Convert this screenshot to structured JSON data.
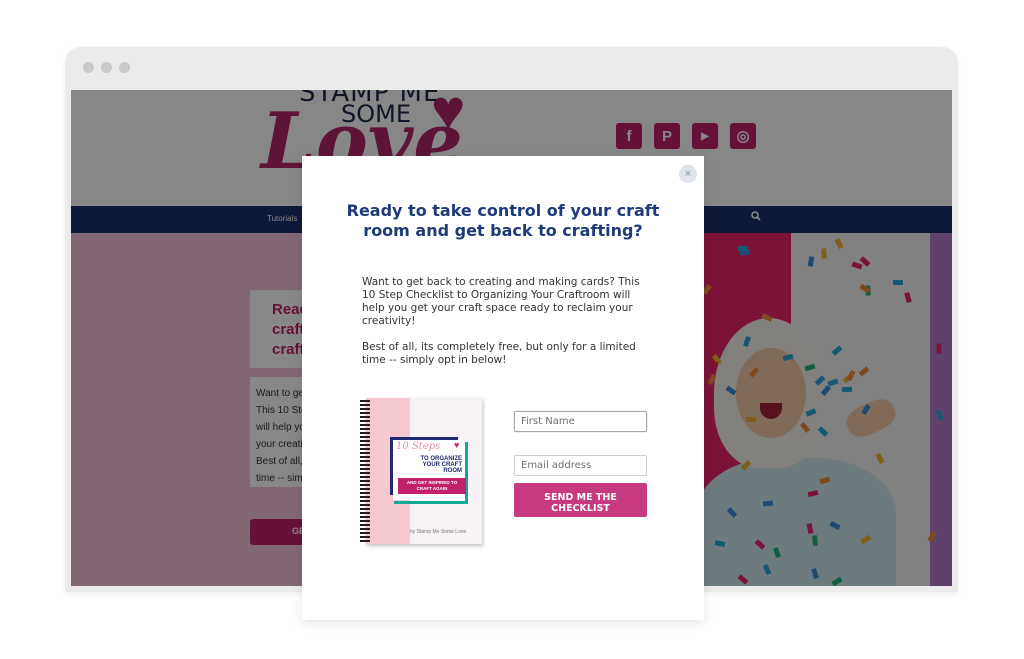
{
  "browser": {
    "window_dots": [
      "dot-1",
      "dot-2",
      "dot-3"
    ]
  },
  "site": {
    "logo": {
      "line1": "STAMP ME",
      "line2": "SOME",
      "line3": "Love",
      "heart_icon": "lace-heart-icon",
      "heart_glyph": "♥"
    },
    "social": [
      {
        "name": "facebook-icon",
        "glyph": "f"
      },
      {
        "name": "pinterest-icon",
        "glyph": "P"
      },
      {
        "name": "youtube-icon",
        "glyph": "▶"
      },
      {
        "name": "instagram-icon",
        "glyph": "◎"
      }
    ],
    "nav": {
      "items": [
        "Tutorials"
      ],
      "search_icon": "🔍"
    },
    "hero": {
      "card_title": "Ready to take control of your\ncraft room and get back to\ncrafting?",
      "card_body": "Want to get back to creating and making cards?\nThis 10 Step Checklist to Organizing Your Craftroom\nwill help you get your craft space ready to reclaim\nyour creativity!\nBest of all, its completely free, but only for a limited\ntime -- simply opt in below!",
      "cta_label": "GET THE CHECKLIST"
    }
  },
  "modal": {
    "close_icon": "×",
    "title": "Ready to take control of your craft room and get back to crafting?",
    "paragraphs": [
      "Want to get back to creating and making cards? This 10 Step Checklist to Organizing Your Craftroom will help you get your craft space ready to reclaim your creativity!",
      "Best of all, its completely free, but only for a limited time -- simply opt in below!"
    ],
    "ebook": {
      "title": "10 Steps",
      "subtitle": "TO ORGANIZE\nYOUR CRAFT\nROOM",
      "tagline": "AND GET INSPIRED TO\nCRAFT AGAIN",
      "author": "by Stamp Me Some Love"
    },
    "form": {
      "first_name_placeholder": "First Name",
      "first_name_value": "",
      "email_placeholder": "Email address",
      "email_value": "",
      "submit_label": "SEND ME THE\nCHECKLIST"
    }
  },
  "colors": {
    "brand_pink": "#c2206a",
    "button_pink": "#c83a80",
    "title_navy": "#1f3a7a",
    "nav_navy": "#1b2f6b",
    "teal": "#14a89a"
  }
}
